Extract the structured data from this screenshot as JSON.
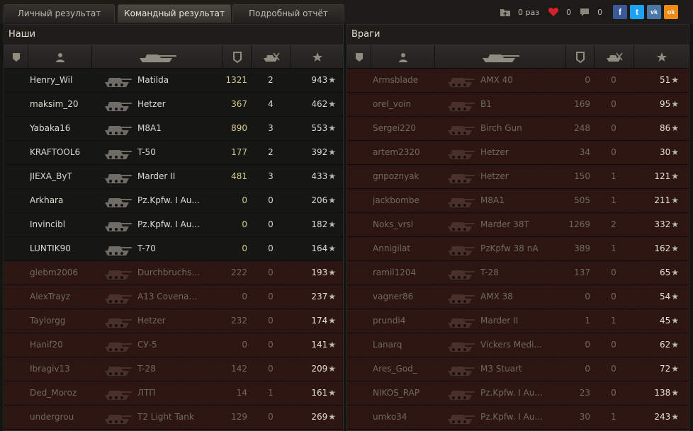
{
  "tabs": [
    {
      "label": "Личный результат",
      "active": false
    },
    {
      "label": "Командный результат",
      "active": true
    },
    {
      "label": "Подробный отчёт",
      "active": false
    }
  ],
  "topbar": {
    "battles_label": "0 раз",
    "likes": "0",
    "comments": "0"
  },
  "social": [
    {
      "name": "fb-icon",
      "label": "f",
      "color": "#3b5998"
    },
    {
      "name": "tw-icon",
      "label": "t",
      "color": "#1da1f2"
    },
    {
      "name": "vk-icon",
      "label": "vk",
      "color": "#4a76a8"
    },
    {
      "name": "ok-icon",
      "label": "ok",
      "color": "#f08a16"
    }
  ],
  "teams": [
    {
      "title": "Наши",
      "rows": [
        {
          "player": "Henry_Wil",
          "vehicle": "Matilda",
          "frags": "1321",
          "kills": "2",
          "damage": "943",
          "alive": true
        },
        {
          "player": "maksim_20",
          "vehicle": "Hetzer",
          "frags": "367",
          "kills": "4",
          "damage": "462",
          "alive": true
        },
        {
          "player": "Yabaka16",
          "vehicle": "M8A1",
          "frags": "890",
          "kills": "3",
          "damage": "553",
          "alive": true
        },
        {
          "player": "KRAFTOOL6",
          "vehicle": "T-50",
          "frags": "177",
          "kills": "2",
          "damage": "392",
          "alive": true
        },
        {
          "player": "JIEXA_ByT",
          "vehicle": "Marder II",
          "frags": "481",
          "kills": "3",
          "damage": "433",
          "alive": true
        },
        {
          "player": "Arkhara",
          "vehicle": "Pz.Kpfw. I Au...",
          "frags": "0",
          "kills": "0",
          "damage": "206",
          "alive": true
        },
        {
          "player": "Invincibl",
          "vehicle": "Pz.Kpfw. I Au...",
          "frags": "0",
          "kills": "0",
          "damage": "182",
          "alive": true
        },
        {
          "player": "LUNTIK90",
          "vehicle": "T-70",
          "frags": "0",
          "kills": "0",
          "damage": "164",
          "alive": true
        },
        {
          "player": "glebm2006",
          "vehicle": "Durchbruchs...",
          "frags": "222",
          "kills": "0",
          "damage": "193",
          "alive": false
        },
        {
          "player": "AlexTrayz",
          "vehicle": "A13 Covenan...",
          "frags": "0",
          "kills": "0",
          "damage": "237",
          "alive": false
        },
        {
          "player": "Taylorgg",
          "vehicle": "Hetzer",
          "frags": "232",
          "kills": "0",
          "damage": "174",
          "alive": false
        },
        {
          "player": "Hanif20",
          "vehicle": "СУ-5",
          "frags": "0",
          "kills": "0",
          "damage": "141",
          "alive": false
        },
        {
          "player": "Ibragiv13",
          "vehicle": "T-28",
          "frags": "142",
          "kills": "0",
          "damage": "209",
          "alive": false
        },
        {
          "player": "Ded_Moroz",
          "vehicle": "ЛТП",
          "frags": "14",
          "kills": "1",
          "damage": "161",
          "alive": false
        },
        {
          "player": "undergrou",
          "vehicle": "T2 Light Tank",
          "frags": "129",
          "kills": "0",
          "damage": "269",
          "alive": false
        }
      ]
    },
    {
      "title": "Враги",
      "rows": [
        {
          "player": "Armsblade",
          "vehicle": "AMX 40",
          "frags": "0",
          "kills": "0",
          "damage": "51",
          "alive": false
        },
        {
          "player": "orel_voin",
          "vehicle": "B1",
          "frags": "169",
          "kills": "0",
          "damage": "95",
          "alive": false
        },
        {
          "player": "Sergei220",
          "vehicle": "Birch Gun",
          "frags": "248",
          "kills": "0",
          "damage": "86",
          "alive": false
        },
        {
          "player": "artem2320",
          "vehicle": "Hetzer",
          "frags": "34",
          "kills": "0",
          "damage": "30",
          "alive": false
        },
        {
          "player": "gnpoznyak",
          "vehicle": "Hetzer",
          "frags": "150",
          "kills": "1",
          "damage": "121",
          "alive": false
        },
        {
          "player": "jackbombe",
          "vehicle": "M8A1",
          "frags": "505",
          "kills": "1",
          "damage": "211",
          "alive": false
        },
        {
          "player": "Noks_vrsl",
          "vehicle": "Marder 38T",
          "frags": "1269",
          "kills": "2",
          "damage": "332",
          "alive": false
        },
        {
          "player": "Annigilat",
          "vehicle": "PzKpfw 38 nA",
          "frags": "389",
          "kills": "1",
          "damage": "162",
          "alive": false
        },
        {
          "player": "ramil1204",
          "vehicle": "T-28",
          "frags": "137",
          "kills": "0",
          "damage": "65",
          "alive": false
        },
        {
          "player": "vagner86",
          "vehicle": "AMX 38",
          "frags": "0",
          "kills": "0",
          "damage": "54",
          "alive": false
        },
        {
          "player": "prundi4",
          "vehicle": "Marder II",
          "frags": "1",
          "kills": "1",
          "damage": "45",
          "alive": false
        },
        {
          "player": "Lanarq",
          "vehicle": "Vickers Medi...",
          "frags": "0",
          "kills": "0",
          "damage": "62",
          "alive": false
        },
        {
          "player": "Ares_God_",
          "vehicle": "M3 Stuart",
          "frags": "0",
          "kills": "0",
          "damage": "72",
          "alive": false
        },
        {
          "player": "NIKOS_RAP",
          "vehicle": "Pz.Kpfw. I Au...",
          "frags": "23",
          "kills": "0",
          "damage": "138",
          "alive": false
        },
        {
          "player": "umko34",
          "vehicle": "Pz.Kpfw. I Au...",
          "frags": "30",
          "kills": "1",
          "damage": "243",
          "alive": false
        }
      ]
    }
  ]
}
